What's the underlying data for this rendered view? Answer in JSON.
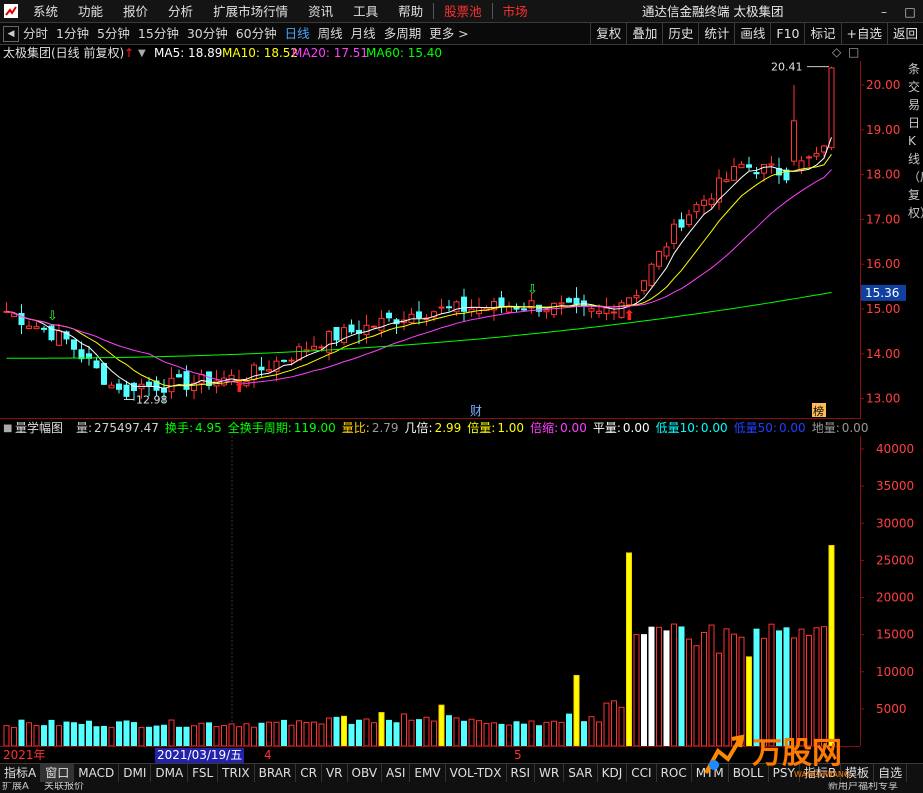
{
  "menubar": {
    "items": [
      "系统",
      "功能",
      "报价",
      "分析",
      "扩展市场行情",
      "资讯",
      "工具",
      "帮助"
    ],
    "hot1": "股票池",
    "hot2": "市场",
    "title": "通达信金融终端  太极集团"
  },
  "periodbar": {
    "items": [
      "分时",
      "1分钟",
      "5分钟",
      "15分钟",
      "30分钟",
      "60分钟",
      "日线",
      "周线",
      "月线",
      "多周期",
      "更多 >"
    ],
    "active": "日线",
    "right": [
      "复权",
      "叠加",
      "历史",
      "统计",
      "画线",
      "F10",
      "标记",
      "+自选",
      "返回"
    ]
  },
  "main_chart": {
    "title": "太极集团(日线 前复权)",
    "ma": [
      {
        "label": "MA5: 18.89",
        "color": "#ffffff"
      },
      {
        "label": "MA10: 18.52",
        "color": "#ffff00"
      },
      {
        "label": "MA20: 17.51",
        "color": "#ff40ff"
      },
      {
        "label": "MA60: 15.40",
        "color": "#00ff00"
      }
    ],
    "price_axis": [
      "20.00",
      "19.00",
      "18.00",
      "17.00",
      "16.00",
      "15.00",
      "14.00",
      "13.00"
    ],
    "current_price": "15.36",
    "high_label": "20.41",
    "low_label": "12.98",
    "event_cai": "财",
    "event_bang": "榜",
    "side_text": "条交易日K线（后复权）",
    "vline_date": "2021/03/19/五"
  },
  "indicator": {
    "name": "量学幅图",
    "items": [
      {
        "label": "量:",
        "value": "275497.47",
        "lc": "#d0d0d0",
        "vc": "#d0d0d0"
      },
      {
        "label": "换手:",
        "value": "4.95",
        "lc": "#00ff00",
        "vc": "#00ff00"
      },
      {
        "label": "全换手周期:",
        "value": "119.00",
        "lc": "#00ff00",
        "vc": "#00ff00"
      },
      {
        "label": "量比:",
        "value": "2.79",
        "lc": "#ffd200",
        "vc": "#9a9a9a"
      },
      {
        "label": "几倍:",
        "value": "2.99",
        "lc": "#ffffff",
        "vc": "#ffff00"
      },
      {
        "label": "倍量:",
        "value": "1.00",
        "lc": "#ffff00",
        "vc": "#ffff00"
      },
      {
        "label": "倍缩:",
        "value": "0.00",
        "lc": "#ff40ff",
        "vc": "#ff40ff"
      },
      {
        "label": "平量:",
        "value": "0.00",
        "lc": "#ffffff",
        "vc": "#ffffff"
      },
      {
        "label": "低量10:",
        "value": "0.00",
        "lc": "#00ffff",
        "vc": "#00ffff"
      },
      {
        "label": "低量50:",
        "value": "0.00",
        "lc": "#2040ff",
        "vc": "#2040ff"
      },
      {
        "label": "地量:",
        "value": "0.00",
        "lc": "#9a9a9a",
        "vc": "#9a9a9a"
      }
    ],
    "vol_axis": [
      "40000",
      "35000",
      "30000",
      "25000",
      "20000",
      "15000",
      "10000",
      "5000"
    ]
  },
  "date_axis": {
    "year": "2021年",
    "cursor": "2021/03/19/五",
    "m4": "4",
    "m5": "5"
  },
  "bottom_tabs": [
    "指标A",
    "窗口",
    "MACD",
    "DMI",
    "DMA",
    "FSL",
    "TRIX",
    "BRAR",
    "CR",
    "VR",
    "OBV",
    "ASI",
    "EMV",
    "VOL-TDX",
    "RSI",
    "WR",
    "SAR",
    "KDJ",
    "CCI",
    "ROC",
    "MTM",
    "BOLL",
    "PSY",
    "指标B",
    "模板",
    "自选"
  ],
  "statusbar": {
    "left1": "扩展A",
    "left2": "关联报价",
    "right": "新用户福利专享"
  },
  "watermark": {
    "text": "万股网",
    "sub": "WANGUWANG"
  }
}
